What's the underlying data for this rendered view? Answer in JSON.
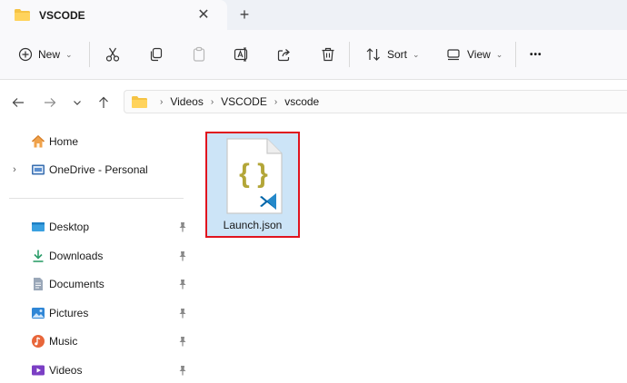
{
  "window": {
    "tab_title": "VSCODE",
    "close_tab_symbol": "✕",
    "new_tab_symbol": "+"
  },
  "toolbar": {
    "new_label": "New",
    "sort_label": "Sort",
    "view_label": "View",
    "more_symbol": "•••",
    "icons": [
      "new-icon",
      "cut-icon",
      "copy-icon",
      "paste-icon",
      "rename-icon",
      "share-icon",
      "delete-icon",
      "sort-icon",
      "view-icon",
      "more-icon"
    ]
  },
  "address": {
    "breadcrumbs": [
      "Videos",
      "VSCODE",
      "vscode"
    ]
  },
  "sidebar": {
    "items": [
      {
        "label": "Home",
        "icon": "home-icon"
      },
      {
        "label": "OneDrive - Personal",
        "icon": "onedrive-icon"
      },
      {
        "label": "Desktop",
        "icon": "desktop-icon"
      },
      {
        "label": "Downloads",
        "icon": "downloads-icon"
      },
      {
        "label": "Documents",
        "icon": "documents-icon"
      },
      {
        "label": "Pictures",
        "icon": "pictures-icon"
      },
      {
        "label": "Music",
        "icon": "music-icon"
      },
      {
        "label": "Videos",
        "icon": "videos-icon"
      }
    ]
  },
  "files": [
    {
      "name": "Launch.json",
      "icon": "json-file-icon",
      "selected": true
    }
  ],
  "colors": {
    "selection": "#cce4f7",
    "highlight_border": "#e0141e",
    "folder": "#f5c344",
    "vscode_blue": "#0065a9",
    "json_braces": "#b3a638"
  }
}
